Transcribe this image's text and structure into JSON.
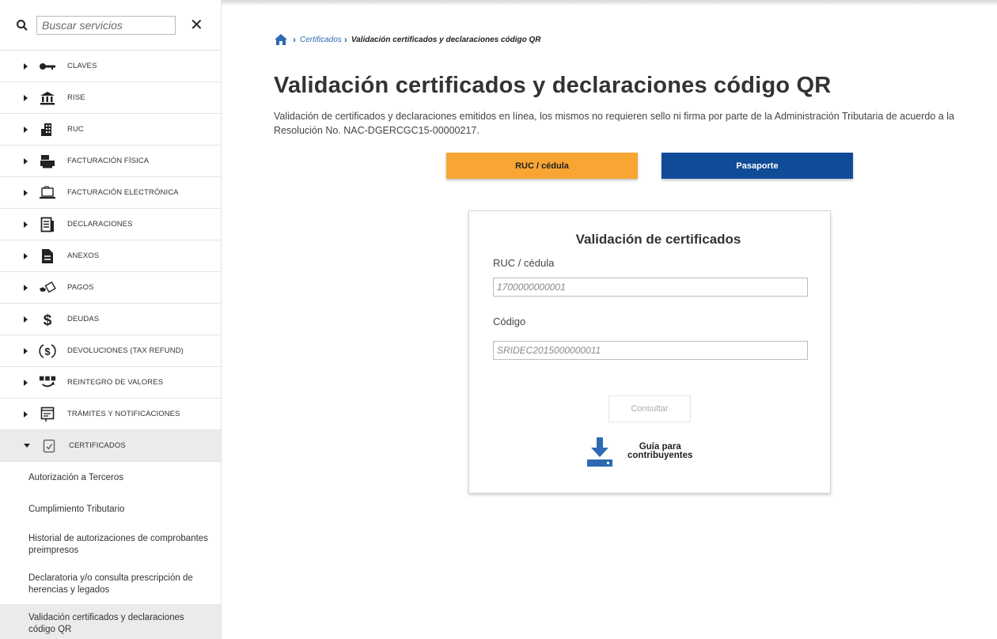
{
  "search": {
    "placeholder": "Buscar servicios",
    "close_label": "✕"
  },
  "menu": [
    {
      "label": "CLAVES",
      "icon": "key-icon"
    },
    {
      "label": "RISE",
      "icon": "bank-icon"
    },
    {
      "label": "RUC",
      "icon": "building-icon"
    },
    {
      "label": "FACTURACIÓN FÍSICA",
      "icon": "printer-icon"
    },
    {
      "label": "FACTURACIÓN ELECTRÓNICA",
      "icon": "laptop-icon"
    },
    {
      "label": "DECLARACIONES",
      "icon": "document-icon"
    },
    {
      "label": "ANEXOS",
      "icon": "file-icon"
    },
    {
      "label": "PAGOS",
      "icon": "payment-hand-icon"
    },
    {
      "label": "DEUDAS",
      "icon": "dollar-icon"
    },
    {
      "label": "DEVOLUCIONES (TAX REFUND)",
      "icon": "dollar-circle-icon"
    },
    {
      "label": "REINTEGRO DE VALORES",
      "icon": "refund-icon"
    },
    {
      "label": "TRÁMITES Y NOTIFICACIONES",
      "icon": "notification-doc-icon"
    },
    {
      "label": "CERTIFICADOS",
      "icon": "certificate-icon"
    }
  ],
  "submenu": [
    {
      "label": "Autorización a Terceros"
    },
    {
      "label": "Cumplimiento Tributario"
    },
    {
      "label": "Historial de autorizaciones de comprobantes preimpresos"
    },
    {
      "label": "Declaratoria y/o consulta prescripción de herencias y legados"
    },
    {
      "label": "Validación certificados y declaraciones código QR"
    }
  ],
  "breadcrumb": {
    "link": "Certificados",
    "current": "Validación certificados y declaraciones código QR"
  },
  "page": {
    "title": "Validación certificados y declaraciones código QR",
    "description": "Validación de certificados y declaraciones emitidos en línea, los mismos no requieren sello ni firma por parte de la Administración Tributaria de acuerdo a la Resolución No. NAC-DGERCGC15-00000217."
  },
  "tabs": {
    "ruc": "RUC / cédula",
    "passport": "Pasaporte"
  },
  "card": {
    "title": "Validación de certificados",
    "ruc_label": "RUC / cédula",
    "ruc_placeholder": "1700000000001",
    "code_label": "Código",
    "code_placeholder": "SRIDEC2015000000011",
    "submit": "Consultar",
    "guide_line1": "Guía para",
    "guide_line2": "contribuyentes"
  },
  "colors": {
    "orange": "#f8a534",
    "navy": "#0f4b97",
    "link": "#2d6ab3"
  }
}
